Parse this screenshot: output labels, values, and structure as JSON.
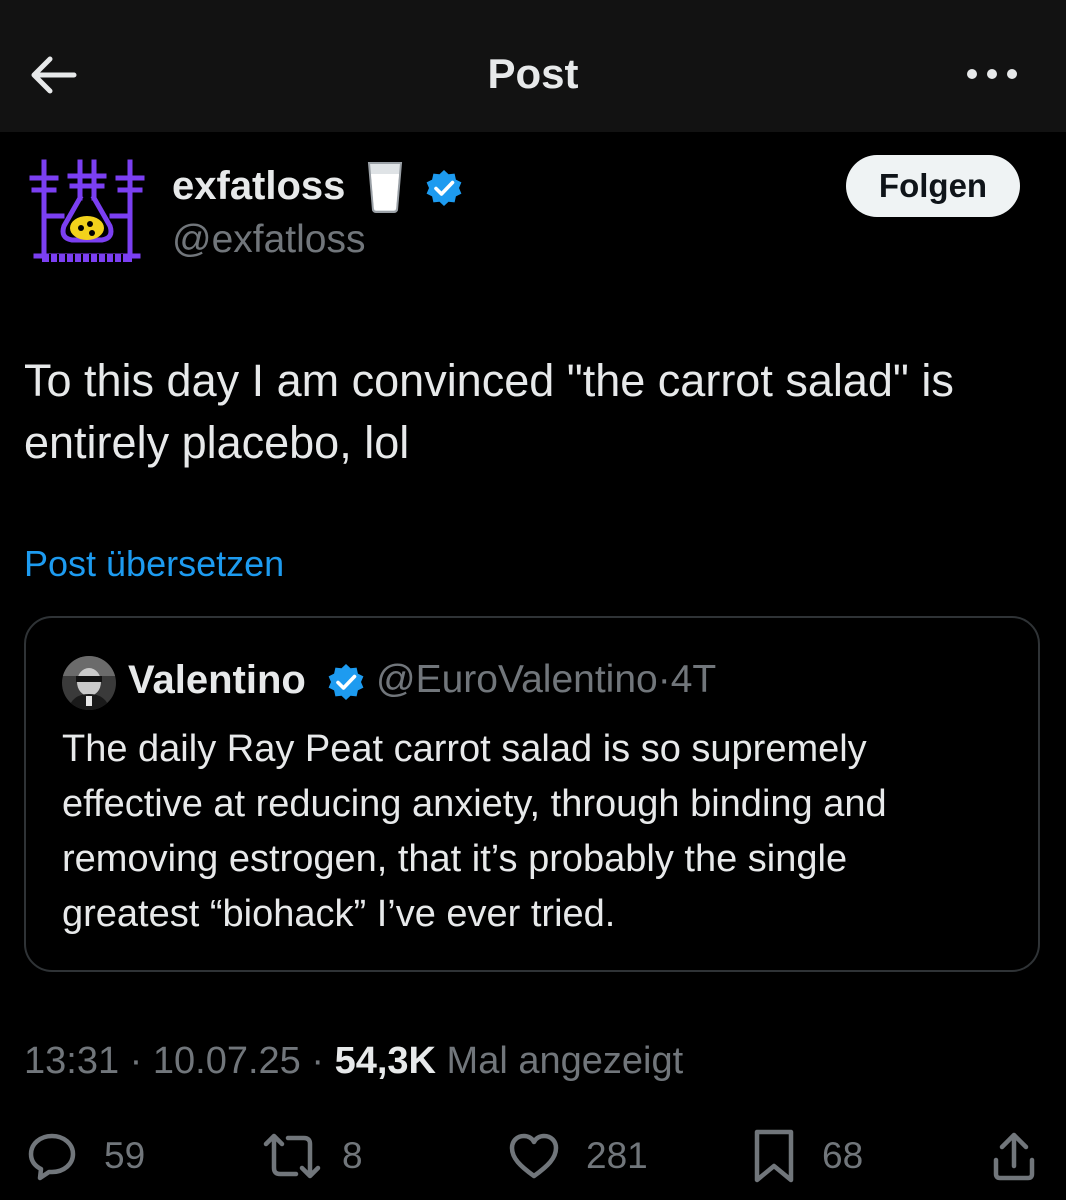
{
  "header": {
    "title": "Post"
  },
  "author": {
    "name": "exfatloss",
    "handle": "@exfatloss"
  },
  "follow_label": "Folgen",
  "post": {
    "text_lines": [
      "To this day I am convinced \"the carrot salad\" is",
      "entirely placebo, lol"
    ]
  },
  "translate_label": "Post übersetzen",
  "quote": {
    "name": "Valentino",
    "handle": "@EuroValentino",
    "separator": "·",
    "age": "4T",
    "text_lines": [
      "The daily Ray Peat carrot salad is so supremely",
      "effective at reducing anxiety, through binding and",
      "removing estrogen, that it’s probably the single",
      "greatest “biohack” I’ve ever tried."
    ]
  },
  "meta": {
    "time": "13:31",
    "date": "10.07.25",
    "separator": "·",
    "views": "54,3K",
    "views_label": "Mal angezeigt"
  },
  "actions": {
    "replies": "59",
    "reposts": "8",
    "likes": "281",
    "bookmarks": "68"
  },
  "colors": {
    "background": "#000000",
    "header_background": "#121212",
    "link": "#1d9bf0",
    "verified": "#1d9bf0",
    "muted_text": "#71767b",
    "avatar_accent": "#7b3ff2",
    "avatar_highlight": "#f2d21b"
  }
}
